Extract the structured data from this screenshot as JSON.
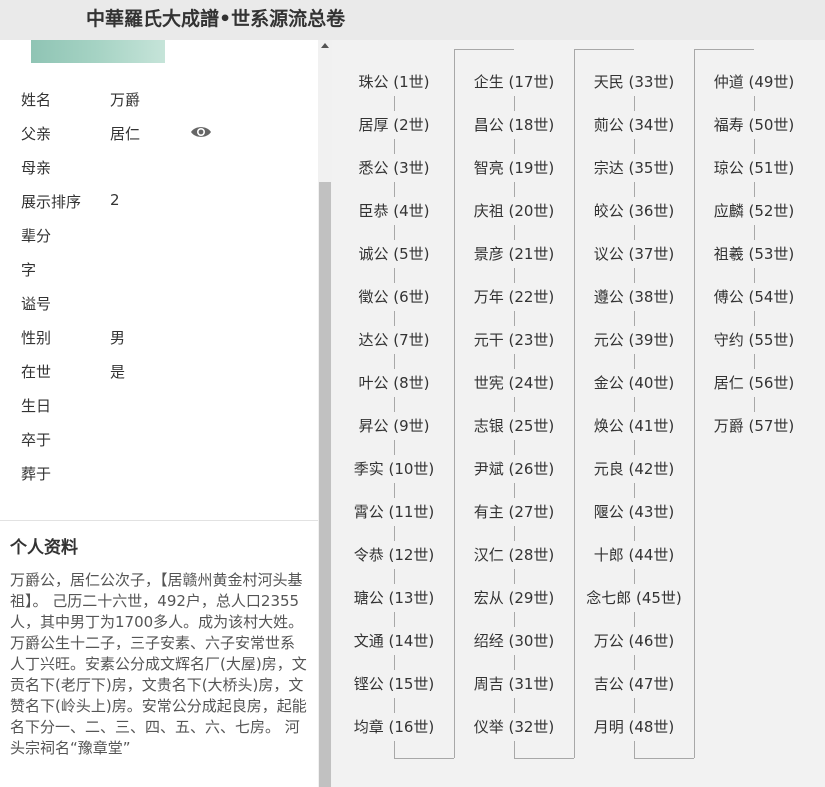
{
  "header": {
    "title": "中華羅氏大成譜•世系源流总卷"
  },
  "person": {
    "fields": [
      {
        "label": "姓名",
        "value": "万爵"
      },
      {
        "label": "父亲",
        "value": "居仁"
      },
      {
        "label": "母亲",
        "value": ""
      },
      {
        "label": "展示排序",
        "value": "2"
      },
      {
        "label": "辈分",
        "value": ""
      },
      {
        "label": "字",
        "value": ""
      },
      {
        "label": "谥号",
        "value": ""
      },
      {
        "label": "性别",
        "value": "男"
      },
      {
        "label": "在世",
        "value": "是"
      },
      {
        "label": "生日",
        "value": ""
      },
      {
        "label": "卒于",
        "value": ""
      },
      {
        "label": "葬于",
        "value": ""
      }
    ]
  },
  "profile": {
    "title": "个人资料",
    "text": "万爵公，居仁公次子，【居赣州黄金村河头基祖】。 己历二十六世，492户，总人口2355人，其中男丁为1700多人。成为该村大姓。万爵公生十二子，三子安素、六子安常世系人丁兴旺。安素公分成文辉名厂(大屋)房，文贡名下(老厅下)房，文贵名下(大桥头)房，文赞名下(岭头上)房。安常公分成起良房，起能名下分一、二、三、四、五、六、七房。 河头宗祠名“豫章堂”"
  },
  "lineage": {
    "columns": [
      [
        "珠公 (1世)",
        "居厚 (2世)",
        "悉公 (3世)",
        "臣恭 (4世)",
        "诚公 (5世)",
        "徵公 (6世)",
        "达公 (7世)",
        "叶公 (8世)",
        "昇公 (9世)",
        "季实 (10世)",
        "霄公 (11世)",
        "令恭 (12世)",
        "瑭公 (13世)",
        "文通 (14世)",
        "铿公 (15世)",
        "均章 (16世)"
      ],
      [
        "企生 (17世)",
        "昌公 (18世)",
        "智亮 (19世)",
        "庆祖 (20世)",
        "景彦 (21世)",
        "万年 (22世)",
        "元干 (23世)",
        "世宪 (24世)",
        "志银 (25世)",
        "尹斌 (26世)",
        "有主 (27世)",
        "汉仁 (28世)",
        "宏从 (29世)",
        "绍经 (30世)",
        "周吉 (31世)",
        "仪举 (32世)"
      ],
      [
        "天民 (33世)",
        "荝公 (34世)",
        "宗达 (35世)",
        "皎公 (36世)",
        "议公 (37世)",
        "遵公 (38世)",
        "元公 (39世)",
        "金公 (40世)",
        "焕公 (41世)",
        "元良 (42世)",
        "隁公 (43世)",
        "十郎 (44世)",
        "念七郎 (45世)",
        "万公 (46世)",
        "吉公 (47世)",
        "月明 (48世)"
      ],
      [
        "仲道 (49世)",
        "福寿 (50世)",
        "琼公 (51世)",
        "应麟 (52世)",
        "祖羲 (53世)",
        "傅公 (54世)",
        "守约 (55世)",
        "居仁 (56世)",
        "万爵 (57世)"
      ]
    ]
  }
}
